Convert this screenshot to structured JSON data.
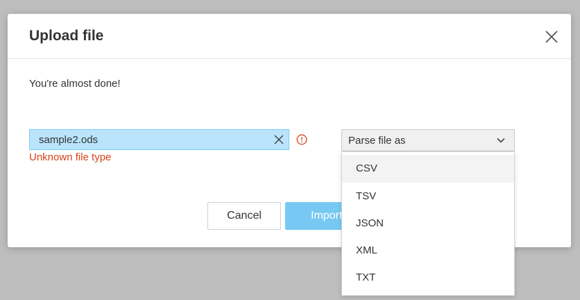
{
  "dialog": {
    "title": "Upload file",
    "message": "You're almost done!",
    "file_name": "sample2.ods",
    "error": "Unknown file type",
    "cancel_label": "Cancel",
    "import_label": "Import",
    "parse_placeholder": "Parse file as",
    "parse_options": [
      "CSV",
      "TSV",
      "JSON",
      "XML",
      "TXT"
    ],
    "highlighted_option": "CSV"
  },
  "icons": {
    "close": "close-icon",
    "clear": "clear-icon",
    "warning": "warning-icon",
    "chevron": "chevron-down-icon"
  },
  "colors": {
    "chip_bg": "#b9e4fb",
    "chip_border": "#7ccdf4",
    "error": "#d9441a",
    "primary": "#77c9f3",
    "overlay": "#bdbdbd"
  }
}
